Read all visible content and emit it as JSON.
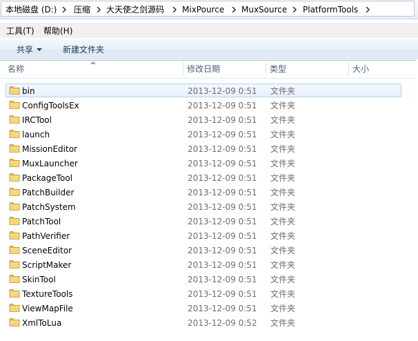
{
  "breadcrumb": {
    "items": [
      "本地磁盘 (D:)",
      "压缩",
      "大天使之剑源码",
      "MixPource",
      "MuxSource",
      "PlatformTools"
    ]
  },
  "menu": {
    "tools": "工具(T)",
    "help": "帮助(H)"
  },
  "commands": {
    "share": "共享",
    "new_folder": "新建文件夹"
  },
  "columns": {
    "name": "名称",
    "modified": "修改日期",
    "type": "类型",
    "size": "大小"
  },
  "files": [
    {
      "name": "bin",
      "modified": "2013-12-09 0:51",
      "type": "文件夹",
      "size": ""
    },
    {
      "name": "ConfigToolsEx",
      "modified": "2013-12-09 0:51",
      "type": "文件夹",
      "size": ""
    },
    {
      "name": "IRCTool",
      "modified": "2013-12-09 0:51",
      "type": "文件夹",
      "size": ""
    },
    {
      "name": "launch",
      "modified": "2013-12-09 0:51",
      "type": "文件夹",
      "size": ""
    },
    {
      "name": "MissionEditor",
      "modified": "2013-12-09 0:51",
      "type": "文件夹",
      "size": ""
    },
    {
      "name": "MuxLauncher",
      "modified": "2013-12-09 0:51",
      "type": "文件夹",
      "size": ""
    },
    {
      "name": "PackageTool",
      "modified": "2013-12-09 0:51",
      "type": "文件夹",
      "size": ""
    },
    {
      "name": "PatchBuilder",
      "modified": "2013-12-09 0:51",
      "type": "文件夹",
      "size": ""
    },
    {
      "name": "PatchSystem",
      "modified": "2013-12-09 0:51",
      "type": "文件夹",
      "size": ""
    },
    {
      "name": "PatchTool",
      "modified": "2013-12-09 0:51",
      "type": "文件夹",
      "size": ""
    },
    {
      "name": "PathVerifier",
      "modified": "2013-12-09 0:51",
      "type": "文件夹",
      "size": ""
    },
    {
      "name": "SceneEditor",
      "modified": "2013-12-09 0:51",
      "type": "文件夹",
      "size": ""
    },
    {
      "name": "ScriptMaker",
      "modified": "2013-12-09 0:51",
      "type": "文件夹",
      "size": ""
    },
    {
      "name": "SkinTool",
      "modified": "2013-12-09 0:51",
      "type": "文件夹",
      "size": ""
    },
    {
      "name": "TextureTools",
      "modified": "2013-12-09 0:51",
      "type": "文件夹",
      "size": ""
    },
    {
      "name": "ViewMapFile",
      "modified": "2013-12-09 0:51",
      "type": "文件夹",
      "size": ""
    },
    {
      "name": "XmlToLua",
      "modified": "2013-12-09 0:52",
      "type": "文件夹",
      "size": ""
    }
  ],
  "selected_index": 0,
  "icons": {
    "folder": "folder-icon",
    "breadcrumb_separator": "chevron-right-icon",
    "share_dropdown": "chevron-down-icon",
    "sort": "sort-ascending-icon"
  },
  "colors": {
    "selection_bg": "#e6f0fb",
    "selection_border": "#b6d1ee",
    "command_text": "#1e395b",
    "header_text": "#4c607a",
    "folder": "#e8c25a"
  }
}
